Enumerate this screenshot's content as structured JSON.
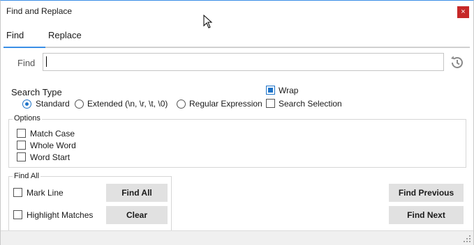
{
  "window": {
    "title": "Find and Replace",
    "close_glyph": "×"
  },
  "tabs": [
    {
      "label": "Find",
      "active": true
    },
    {
      "label": "Replace",
      "active": false
    }
  ],
  "find": {
    "label": "Find",
    "value": "",
    "history_icon": "history-icon"
  },
  "search_type": {
    "title": "Search Type",
    "options": [
      {
        "label": "Standard",
        "checked": true
      },
      {
        "label": "Extended (\\n, \\r, \\t, \\0)",
        "checked": false
      },
      {
        "label": "Regular Expression",
        "checked": false
      }
    ]
  },
  "wrap": {
    "label": "Wrap",
    "checked": true
  },
  "search_selection": {
    "label": "Search Selection",
    "checked": false
  },
  "options": {
    "title": "Options",
    "items": [
      {
        "label": "Match Case",
        "checked": false
      },
      {
        "label": "Whole Word",
        "checked": false
      },
      {
        "label": "Word Start",
        "checked": false
      }
    ]
  },
  "find_all": {
    "title": "Find All",
    "mark_line": {
      "label": "Mark Line",
      "checked": false
    },
    "highlight": {
      "label": "Highlight Matches",
      "checked": false
    },
    "find_all_button": "Find All",
    "clear_button": "Clear"
  },
  "buttons": {
    "find_previous": "Find Previous",
    "find_next": "Find Next"
  },
  "colors": {
    "accent": "#1e73c8",
    "tab_underline": "#3a8ee6",
    "close": "#c62828",
    "button_bg": "#e1e1e1"
  }
}
